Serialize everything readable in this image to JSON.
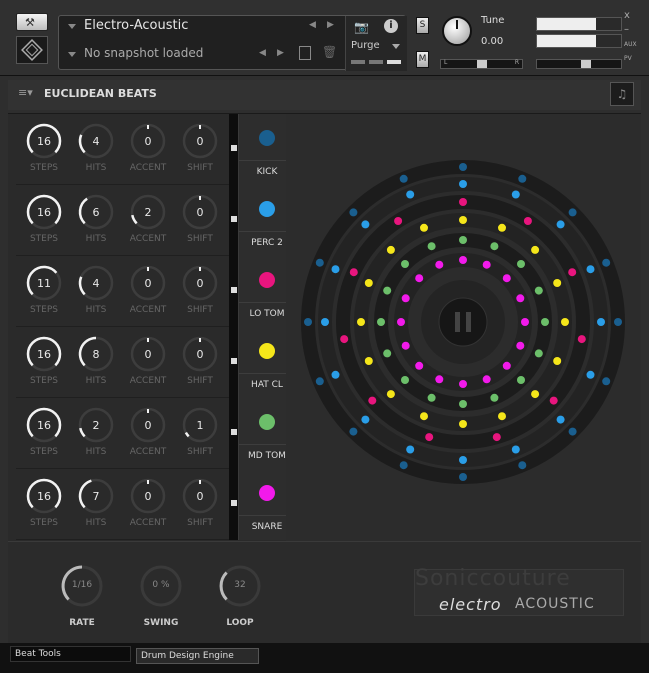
{
  "header": {
    "instrument_name": "Electro-Acoustic",
    "snapshot": "No snapshot loaded",
    "purge_label": "Purge",
    "tune_label": "Tune",
    "tune_value": "0.00",
    "solo_label": "S",
    "mute_label": "M",
    "pan_left": "L",
    "pan_right": "R",
    "aux_label": "AUX",
    "pv_label": "PV",
    "close_glyph": "x",
    "minimize_glyph": "–"
  },
  "title": {
    "text": "EUCLIDEAN BEATS"
  },
  "row_labels": {
    "steps": "STEPS",
    "hits": "HITS",
    "accent": "ACCENT",
    "shift": "SHIFT"
  },
  "rows": [
    {
      "name": "KICK",
      "steps": "16",
      "hits": "4",
      "accent": "0",
      "shift": "0",
      "color": "#1a5f8f"
    },
    {
      "name": "PERC 2",
      "steps": "16",
      "hits": "6",
      "accent": "2",
      "shift": "0",
      "color": "#2a9ee8"
    },
    {
      "name": "LO TOM",
      "steps": "11",
      "hits": "4",
      "accent": "0",
      "shift": "0",
      "color": "#e8157e"
    },
    {
      "name": "HAT CL",
      "steps": "16",
      "hits": "8",
      "accent": "0",
      "shift": "0",
      "color": "#f5e61a"
    },
    {
      "name": "MD TOM",
      "steps": "16",
      "hits": "2",
      "accent": "0",
      "shift": "1",
      "color": "#6cbf6a"
    },
    {
      "name": "SNARE",
      "steps": "16",
      "hits": "7",
      "accent": "0",
      "shift": "0",
      "color": "#f21aeb"
    }
  ],
  "bottom": {
    "rate_label": "RATE",
    "rate_value": "1/16",
    "swing_label": "SWING",
    "swing_value": "0 %",
    "loop_label": "LOOP",
    "loop_value": "32"
  },
  "logo": {
    "brand": "Soniccouture",
    "product_a": "electro",
    "product_b": "ACOUSTIC"
  },
  "tabs": [
    {
      "label": "Beat Tools"
    },
    {
      "label": "Drum Design Engine"
    }
  ],
  "icons": {
    "wrench": "wrench-icon",
    "logo": "kontakt-logo-icon",
    "camera": "camera-icon",
    "info": "info-icon",
    "save": "save-icon",
    "trash": "trash-icon",
    "menu": "menu-icon",
    "note": "music-note-icon",
    "pause": "pause-icon"
  }
}
